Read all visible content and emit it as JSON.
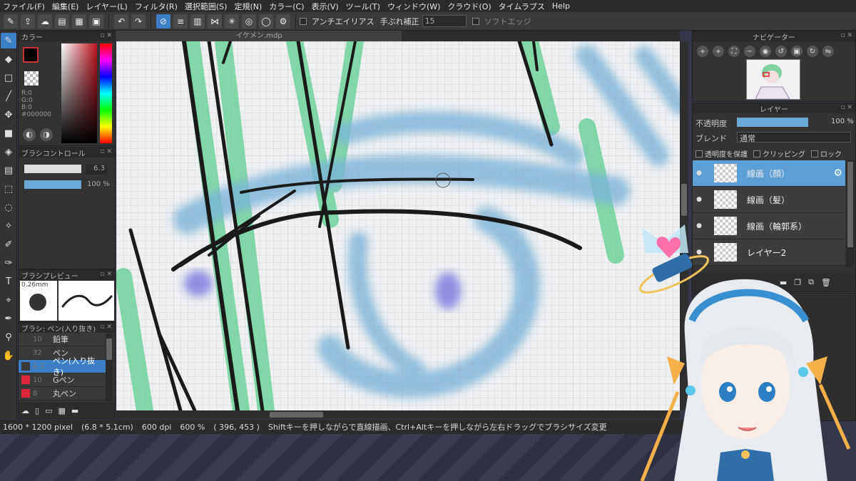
{
  "menu": [
    "ファイル(F)",
    "編集(E)",
    "レイヤー(L)",
    "フィルタ(R)",
    "選択範囲(S)",
    "定規(N)",
    "カラー(C)",
    "表示(V)",
    "ツール(T)",
    "ウィンドウ(W)",
    "クラウド(O)",
    "タイムラプス",
    "Help"
  ],
  "toolbar": {
    "antialias_label": "アンチエイリアス",
    "stabilizer_label": "手ぶれ補正",
    "stabilizer_value": "15",
    "soft_edge_label": "ソフトエッジ"
  },
  "document_tab": "イケメン.mdp",
  "color_panel": {
    "title": "カラー",
    "r": "R:0",
    "g": "G:0",
    "b": "B:0",
    "hex": "#000000"
  },
  "brush_control": {
    "title": "ブラシコントロール",
    "size": "6.3",
    "opacity": "100 %"
  },
  "brush_preview": {
    "title": "ブラシプレビュー",
    "size": "0.26mm"
  },
  "brush_list": {
    "title": "ブラシ: ペン(入り抜き)",
    "items": [
      {
        "size": "10",
        "name": "鉛筆",
        "color": "#3a3a3a"
      },
      {
        "size": "32",
        "name": "ペン",
        "color": "#3a3a3a"
      },
      {
        "size": "6.3",
        "name": "ペン(入り抜き)",
        "color": "#3a3a3a",
        "selected": true
      },
      {
        "size": "10",
        "name": "Gペン",
        "color": "#e0283c"
      },
      {
        "size": "8",
        "name": "丸ペン",
        "color": "#e0283c"
      }
    ]
  },
  "navigator": {
    "title": "ナビゲーター"
  },
  "layers": {
    "title": "レイヤー",
    "opacity_label": "不透明度",
    "opacity_value": "100 %",
    "blend_label": "ブレンド",
    "blend_value": "通常",
    "protect_label": "透明度を保護",
    "clipping_label": "クリッピング",
    "lock_label": "ロック",
    "items": [
      {
        "name": "線画（顔）",
        "selected": true
      },
      {
        "name": "線画（髪）"
      },
      {
        "name": "線画（輪郭系）"
      },
      {
        "name": "レイヤー2"
      }
    ]
  },
  "status": {
    "size": "1600 * 1200 pixel",
    "cm": "(6.8 * 5.1cm)",
    "dpi": "600 dpi",
    "zoom": "600 %",
    "coords": "( 396, 453 )",
    "hint": "Shiftキーを押しながらで直線描画、Ctrl+Altキーを押しながら左右ドラッグでブラシサイズ変更"
  },
  "colors": {
    "accent": "#3d7fc7",
    "layer_selected": "#5b9fd6"
  }
}
